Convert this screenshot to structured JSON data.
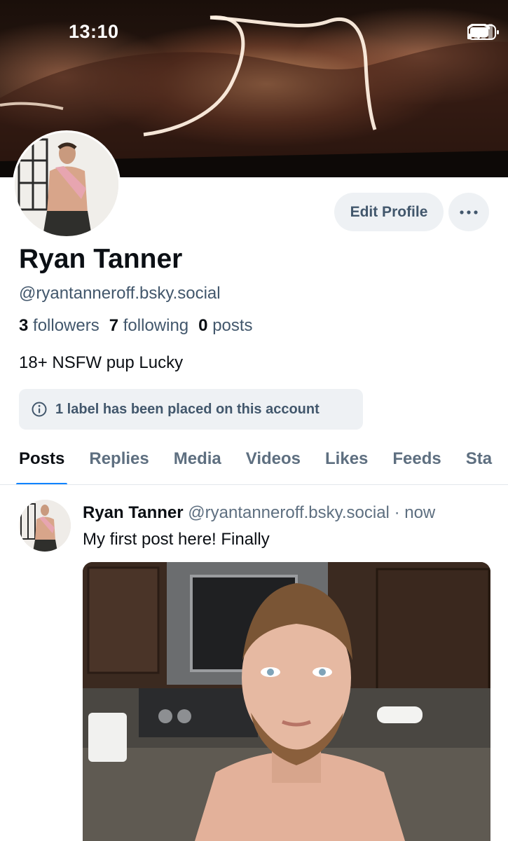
{
  "status_bar": {
    "time": "13:10"
  },
  "profile": {
    "display_name": "Ryan Tanner",
    "handle": "@ryantanneroff.bsky.social",
    "followers_count": "3",
    "followers_label": "followers",
    "following_count": "7",
    "following_label": "following",
    "posts_count": "0",
    "posts_label": "posts",
    "bio": "18+ NSFW pup Lucky",
    "label_notice": "1 label has been placed on this account"
  },
  "actions": {
    "edit_profile": "Edit Profile",
    "more_icon": "ellipsis-icon"
  },
  "tabs": [
    {
      "label": "Posts",
      "active": true
    },
    {
      "label": "Replies",
      "active": false
    },
    {
      "label": "Media",
      "active": false
    },
    {
      "label": "Videos",
      "active": false
    },
    {
      "label": "Likes",
      "active": false
    },
    {
      "label": "Feeds",
      "active": false
    },
    {
      "label": "Sta",
      "active": false
    }
  ],
  "post": {
    "author": "Ryan Tanner",
    "handle": "@ryantanneroff.bsky.social",
    "separator": "·",
    "time": "now",
    "text": "My first post here! Finally"
  },
  "colors": {
    "accent": "#1083fe",
    "muted_text": "#42576c",
    "pill_bg": "#eef1f4"
  }
}
